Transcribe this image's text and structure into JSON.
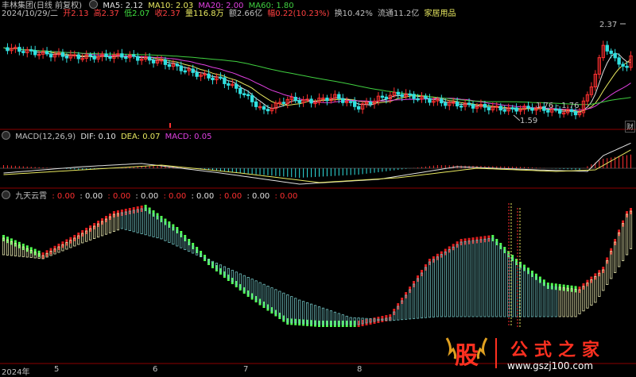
{
  "main_panel": {
    "title": "丰林集团(日线 前复权)",
    "ma": [
      {
        "label": "MA5: 2.12",
        "color": "#e0e0e0"
      },
      {
        "label": "MA10: 2.03",
        "color": "#e8e860"
      },
      {
        "label": "MA20: 2.00",
        "color": "#e040e0"
      },
      {
        "label": "MA60: 1.80",
        "color": "#40d040"
      }
    ],
    "quote": [
      {
        "text": "2024/10/29/二",
        "color": "#c0c0c0"
      },
      {
        "text": "开2.13",
        "color": "#ff4040"
      },
      {
        "text": "高2.37",
        "color": "#ff4040"
      },
      {
        "text": "低2.07",
        "color": "#40e040"
      },
      {
        "text": "收2.37",
        "color": "#ff4040"
      },
      {
        "text": "量116.8万",
        "color": "#e8e860"
      },
      {
        "text": "额2.66亿",
        "color": "#c0c0c0"
      },
      {
        "text": "幅0.22(10.23%)",
        "color": "#ff4040"
      },
      {
        "text": "换10.42%",
        "color": "#c0c0c0"
      },
      {
        "text": "流通11.2亿",
        "color": "#c0c0c0"
      },
      {
        "text": "家居用品",
        "color": "#e8e860"
      }
    ],
    "annotations": {
      "high": "2.37",
      "low": "1.59",
      "mid": "1.76 - 1.76"
    },
    "right_marker": "财"
  },
  "macd_panel": {
    "title": "MACD(12,26,9)",
    "dif": "DIF: 0.10",
    "dea": "DEA: 0.07",
    "macd": "MACD: 0.05"
  },
  "custom_panel": {
    "title": "九天云霄",
    "values": [
      ": 0.00",
      ": 0.00",
      ": 0.00",
      ": 0.00",
      ": 0.00",
      ": 0.00",
      ": 0.00",
      ": 0.00",
      ": 0.00"
    ]
  },
  "time_axis": [
    "2024年",
    "5",
    "6",
    "7",
    "8"
  ],
  "watermark": {
    "logo": "股",
    "name": "公式之家",
    "url": "www.gszj100.com"
  },
  "colors": {
    "up": "#ff3030",
    "down": "#30e0e0",
    "bull": "#50ff50",
    "bear": "#e02020"
  }
}
